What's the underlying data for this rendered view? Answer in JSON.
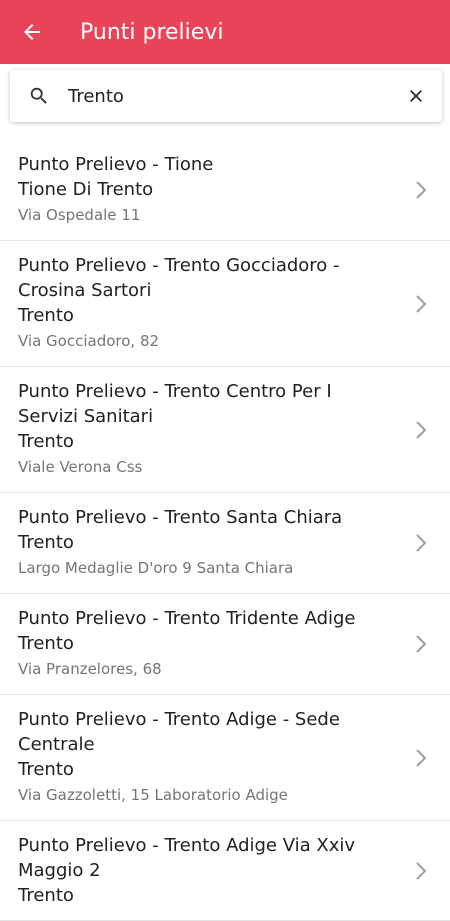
{
  "header": {
    "title": "Punti prelievi",
    "back_icon": "arrow-left-icon",
    "color": "#e8445a"
  },
  "search": {
    "value": "Trento",
    "search_icon": "search-icon",
    "clear_icon": "close-icon"
  },
  "results": [
    {
      "name": "Punto Prelievo - Tione",
      "city": "Tione Di Trento",
      "address": "Via Ospedale 11"
    },
    {
      "name": "Punto Prelievo - Trento Gocciadoro - Crosina Sartori",
      "city": "Trento",
      "address": "Via Gocciadoro, 82"
    },
    {
      "name": "Punto Prelievo - Trento Centro Per I Servizi Sanitari",
      "city": "Trento",
      "address": "Viale Verona Css"
    },
    {
      "name": "Punto Prelievo - Trento Santa Chiara",
      "city": "Trento",
      "address": "Largo Medaglie D'oro 9 Santa Chiara"
    },
    {
      "name": "Punto Prelievo - Trento Tridente Adige",
      "city": "Trento",
      "address": "Via Pranzelores, 68"
    },
    {
      "name": "Punto Prelievo - Trento Adige - Sede Centrale",
      "city": "Trento",
      "address": "Via Gazzoletti, 15 Laboratorio Adige"
    },
    {
      "name": "Punto Prelievo - Trento Adige Via Xxiv Maggio 2",
      "city": "Trento",
      "address": ""
    }
  ]
}
